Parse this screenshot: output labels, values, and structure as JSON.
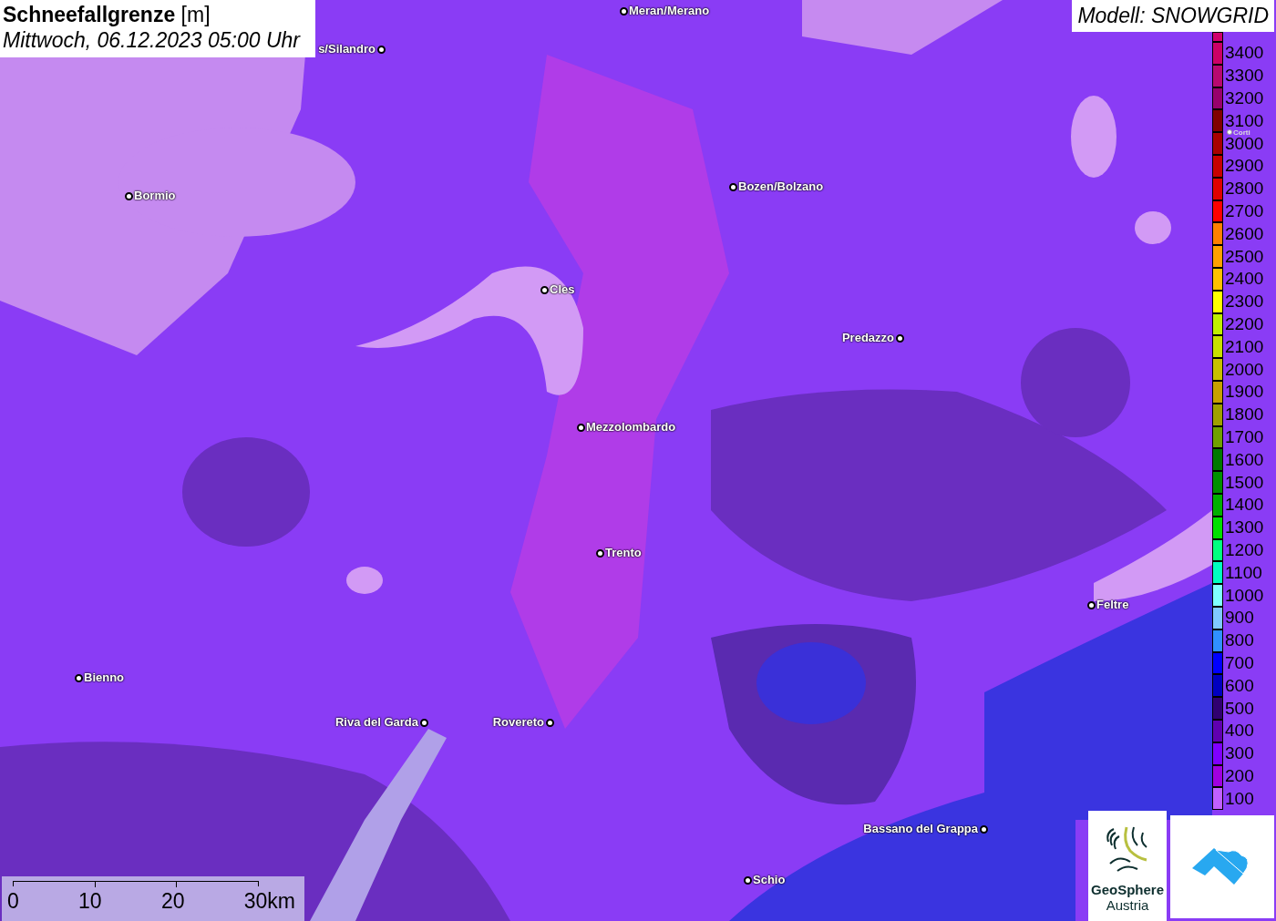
{
  "title": "**Schneefallgrenze** [m]",
  "subtitle": "Mittwoch, 06.12.2023 05:00 Uhr",
  "model_label": "Modell: SNOWGRID",
  "places": [
    {
      "name": "Meran/Merano"
    },
    {
      "name": "s/Silandro"
    },
    {
      "name": "Bormio"
    },
    {
      "name": "Bozen/Bolzano"
    },
    {
      "name": "Cles"
    },
    {
      "name": "Predazzo"
    },
    {
      "name": "Mezzolombardo"
    },
    {
      "name": "Trento"
    },
    {
      "name": "Feltre"
    },
    {
      "name": "Bienno"
    },
    {
      "name": "Riva del Garda"
    },
    {
      "name": "Rovereto"
    },
    {
      "name": "Bassano del Grappa"
    },
    {
      "name": "Schio"
    },
    {
      "name": "Corti"
    }
  ],
  "legend": [
    {
      "color": "#d0006c"
    },
    {
      "label": "3400",
      "color": "#cc0066"
    },
    {
      "label": "3300",
      "color": "#b80870"
    },
    {
      "label": "3200",
      "color": "#98006c"
    },
    {
      "label": "3100",
      "color": "#800000"
    },
    {
      "label": "3000",
      "color": "#a80000"
    },
    {
      "label": "2900",
      "color": "#c80000"
    },
    {
      "label": "2800",
      "color": "#e00000"
    },
    {
      "label": "2700",
      "color": "#ff0000"
    },
    {
      "label": "2600",
      "color": "#ff8000"
    },
    {
      "label": "2500",
      "color": "#ffa000"
    },
    {
      "label": "2400",
      "color": "#ffc000"
    },
    {
      "label": "2300",
      "color": "#ffff00"
    },
    {
      "label": "2200",
      "color": "#c0f000"
    },
    {
      "label": "2100",
      "color": "#c8e000"
    },
    {
      "label": "2000",
      "color": "#c8c000"
    },
    {
      "label": "1900",
      "color": "#c8a000"
    },
    {
      "label": "1800",
      "color": "#a0a000"
    },
    {
      "label": "1700",
      "color": "#70a000"
    },
    {
      "label": "1600",
      "color": "#007800"
    },
    {
      "label": "1500",
      "color": "#009000"
    },
    {
      "label": "1400",
      "color": "#00b000"
    },
    {
      "label": "1300",
      "color": "#00e000"
    },
    {
      "label": "1200",
      "color": "#00ff80"
    },
    {
      "label": "1100",
      "color": "#00ffc0"
    },
    {
      "label": "1000",
      "color": "#80ffff"
    },
    {
      "label": "900",
      "color": "#80c8ff"
    },
    {
      "label": "800",
      "color": "#3090ff"
    },
    {
      "label": "700",
      "color": "#0000ff"
    },
    {
      "label": "600",
      "color": "#0000c0"
    },
    {
      "label": "500",
      "color": "#300070"
    },
    {
      "label": "400",
      "color": "#6000b0"
    },
    {
      "label": "300",
      "color": "#8000ff"
    },
    {
      "label": "200",
      "color": "#a000e0"
    },
    {
      "label": "100",
      "color": "#c060ff"
    }
  ],
  "scale": {
    "ticks": [
      "0",
      "10",
      "20",
      "30km"
    ]
  },
  "logo": {
    "name": "GeoSphere",
    "subname": "Austria"
  }
}
